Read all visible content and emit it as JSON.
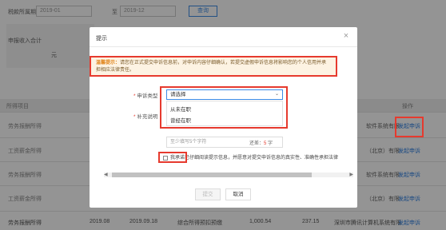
{
  "filters": {
    "label": "税款所属期",
    "date_from": "2019-01",
    "separator": "至",
    "date_to": "2019-12",
    "query_label": "查询"
  },
  "summary": {
    "label": "申报收入合计",
    "unit": "元"
  },
  "table": {
    "type_header": "所得项目",
    "op_header": "操作",
    "rows": [
      {
        "label": "劳务报酬所得",
        "right": "软件系统有限",
        "link": "发起申诉"
      },
      {
        "label": "工资薪金所得",
        "right": "（北京）有限",
        "link": "发起申诉"
      },
      {
        "label": "劳务报酬所得",
        "right": "软件系统有限",
        "link": "发起申诉"
      },
      {
        "label": "工资薪金所得",
        "right": "（北京）有限",
        "link": "发起申诉"
      }
    ]
  },
  "footer_row": {
    "type": "劳务报酬所得",
    "start": "2019.08",
    "end": "2019.09.18",
    "item": "综合所得预扣预缴",
    "amount": "1,000.54",
    "tax": "237.15",
    "company": "深圳市腾讯计算机系统有限",
    "link": "发起申诉"
  },
  "dialog": {
    "title": "提示",
    "close_glyph": "×",
    "warning_label": "温馨提示：",
    "warning_text": "请您在正式提交申诉信息前，对申诉内容仔细确认，若提交虚假申诉信息将影响您的个人信用并承担相应法律责任。",
    "type_label": "申诉类型",
    "extra_label": "补充说明",
    "select_placeholder": "请选择",
    "select_arrow": "⌄",
    "options": [
      "从未在职",
      "曾经在职"
    ],
    "textarea_placeholder": "至少填写5个字符",
    "remain_label": "还差：",
    "remain_count": "5",
    "remain_unit": "字",
    "agree_text": "我承诺已仔细阅读提示信息，并愿意对提交申诉信息的真实性、准确性承担法律",
    "scroll_left": "◀",
    "scroll_right": "▶",
    "submit_label": "提交",
    "cancel_label": "取消"
  },
  "colors": {
    "accent": "#3d8ce6",
    "highlight": "#e63a2e",
    "warning_bg": "#fdf3e3"
  }
}
